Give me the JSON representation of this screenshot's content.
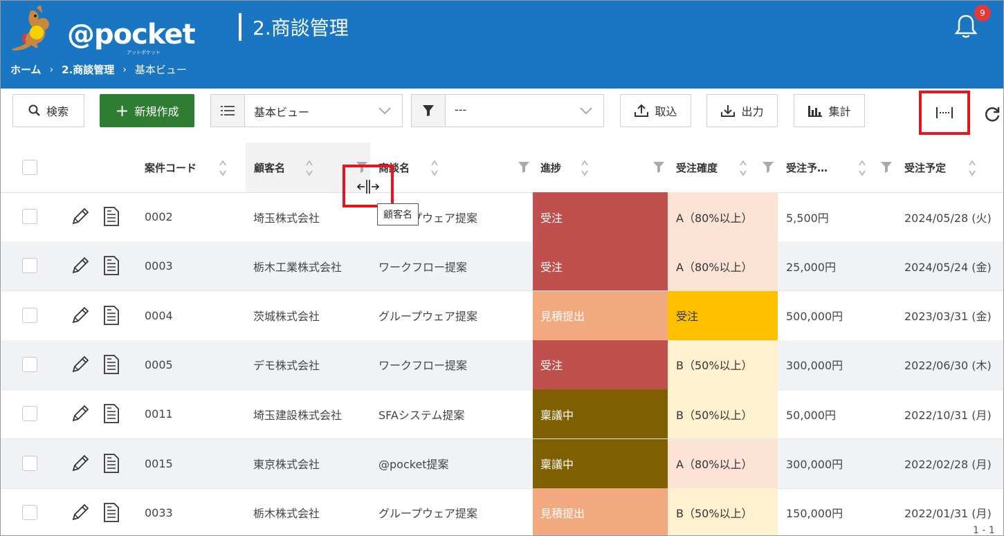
{
  "app": {
    "logo_text": "@pocket",
    "logo_sub": "アットポケット",
    "page_title": "2.商談管理",
    "notification_count": "9"
  },
  "breadcrumb": [
    {
      "label": "ホーム"
    },
    {
      "label": "2.商談管理"
    },
    {
      "label": "基本ビュー"
    }
  ],
  "toolbar": {
    "search_label": "検索",
    "new_label": "新規作成",
    "view_select_value": "基本ビュー",
    "filter_select_value": "---",
    "import_label": "取込",
    "export_label": "出力",
    "aggregate_label": "集計"
  },
  "table": {
    "columns": [
      "案件コード",
      "顧客名",
      "商談名",
      "進捗",
      "受注確度",
      "受注予…",
      "受注予定"
    ],
    "tooltip": "顧客名",
    "rows": [
      {
        "code": "0002",
        "customer": "埼玉株式会社",
        "deal": "グループウェア提案",
        "status": "受注",
        "status_color": "#c0504d",
        "prob": "A（80%以上）",
        "prob_color": "#fde2d6",
        "amount": "5,500円",
        "date": "2024/05/28 (火)"
      },
      {
        "code": "0003",
        "customer": "栃木工業株式会社",
        "deal": "ワークフロー提案",
        "status": "受注",
        "status_color": "#c0504d",
        "prob": "A（80%以上）",
        "prob_color": "#fde2d6",
        "amount": "25,000円",
        "date": "2024/05/24 (金)"
      },
      {
        "code": "0004",
        "customer": "茨城株式会社",
        "deal": "グループウェア提案",
        "status": "見積提出",
        "status_color": "#f2a97f",
        "prob": "受注",
        "prob_color": "#ffc000",
        "amount": "500,000円",
        "date": "2023/03/31 (金)"
      },
      {
        "code": "0005",
        "customer": "デモ株式会社",
        "deal": "ワークフロー提案",
        "status": "受注",
        "status_color": "#c0504d",
        "prob": "B（50%以上）",
        "prob_color": "#fff0cf",
        "amount": "300,000円",
        "date": "2022/06/30 (木)"
      },
      {
        "code": "0011",
        "customer": "埼玉建設株式会社",
        "deal": "SFAシステム提案",
        "status": "稟議中",
        "status_color": "#7f6000",
        "prob": "B（50%以上）",
        "prob_color": "#fff0cf",
        "amount": "50,000円",
        "date": "2022/10/31 (月)"
      },
      {
        "code": "0015",
        "customer": "東京株式会社",
        "deal": "@pocket提案",
        "status": "稟議中",
        "status_color": "#7f6000",
        "prob": "A（80%以上）",
        "prob_color": "#fde2d6",
        "amount": "300,000円",
        "date": "2022/02/28 (月)"
      },
      {
        "code": "0033",
        "customer": "栃木株式会社",
        "deal": "グループウェア提案",
        "status": "見積提出",
        "status_color": "#f2a97f",
        "prob": "B（50%以上）",
        "prob_color": "#fff0cf",
        "amount": "150,000円",
        "date": "2022/01/31 (月)"
      }
    ]
  },
  "pager_text": "1 - 1"
}
